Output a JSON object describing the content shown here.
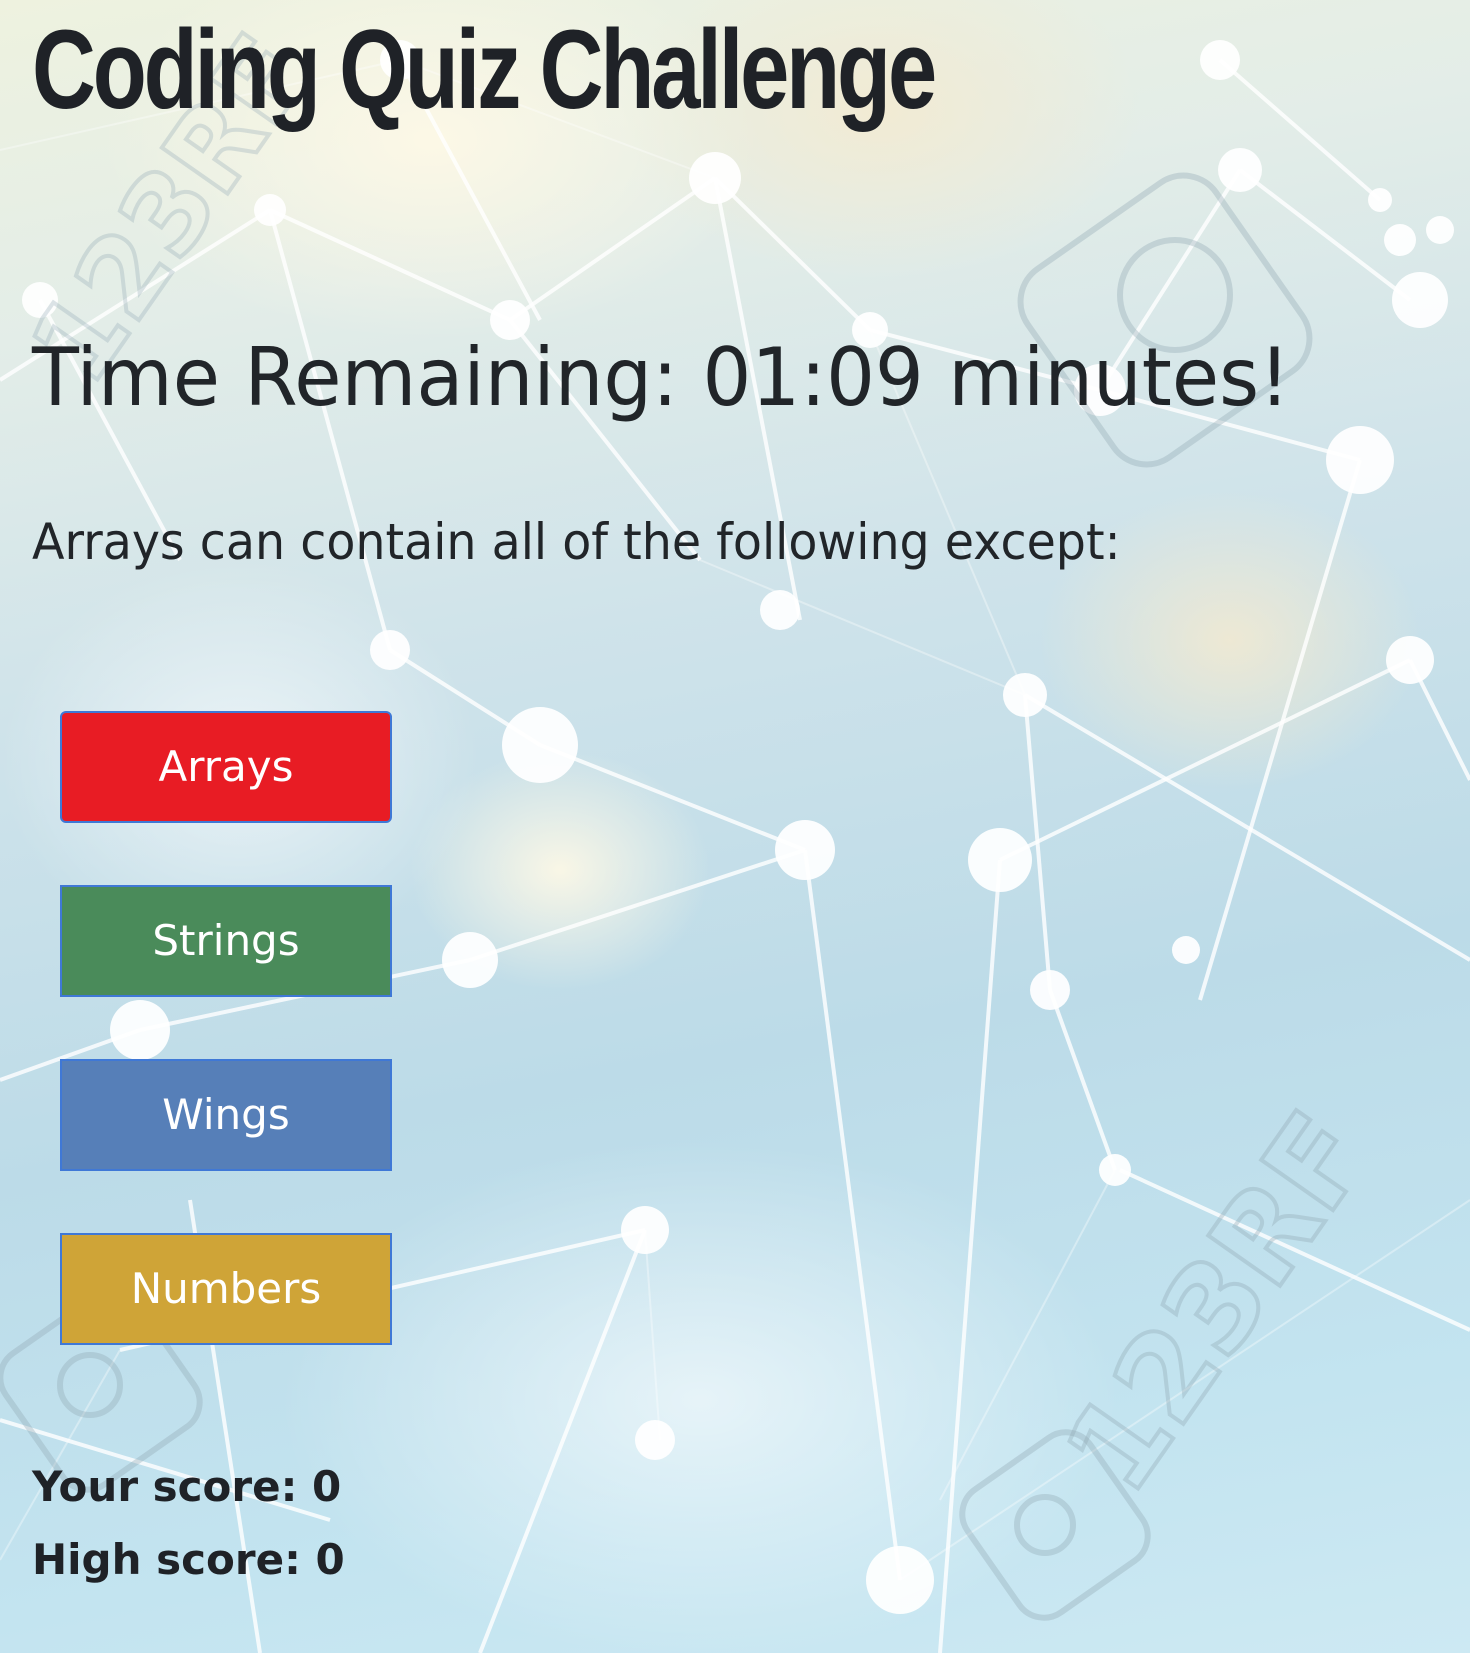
{
  "page": {
    "title": "Coding Quiz Challenge"
  },
  "timer": {
    "text": "Time Remaining: 01:09 minutes!",
    "value": "01:09"
  },
  "question": {
    "text": "Arrays can contain all of the following except:"
  },
  "answers": [
    {
      "label": "Arrays",
      "color": "#e81c24"
    },
    {
      "label": "Strings",
      "color": "#4a8b5a"
    },
    {
      "label": "Wings",
      "color": "#567fb8"
    },
    {
      "label": "Numbers",
      "color": "#cfa437"
    }
  ],
  "scores": {
    "your_score": "Your score: 0",
    "high_score": "High score: 0"
  },
  "background": {
    "watermark": "123RF"
  }
}
